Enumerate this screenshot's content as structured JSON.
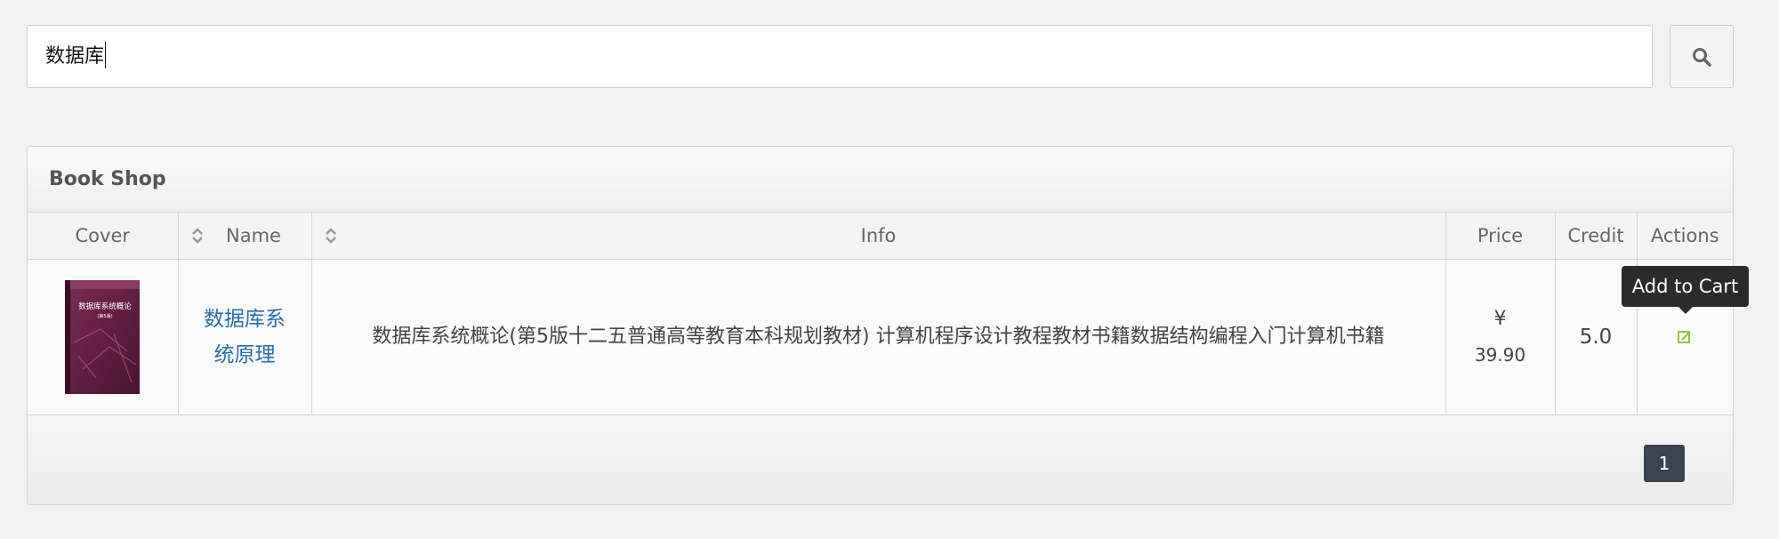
{
  "search": {
    "value": "数据库",
    "icon": "search-icon"
  },
  "panel": {
    "title": "Book Shop"
  },
  "table": {
    "columns": {
      "cover": "Cover",
      "name": "Name",
      "info": "Info",
      "price": "Price",
      "credit": "Credit",
      "actions": "Actions"
    },
    "rows": [
      {
        "cover_title": "数据库系统概论",
        "cover_edition": "(第5版)",
        "name": "数据库系统原理",
        "info": "数据库系统概论(第5版十二五普通高等教育本科规划教材) 计算机程序设计教程教材书籍数据结构编程入门计算机书籍",
        "price_symbol": "¥",
        "price": "39.90",
        "credit": "5.0",
        "action_icon": "edit-icon"
      }
    ]
  },
  "tooltip": {
    "text": "Add to Cart"
  },
  "pagination": {
    "current_page": "1"
  },
  "colors": {
    "link": "#2a6ea8",
    "action_icon": "#8dc63f",
    "pagination_bg": "#3a4350",
    "tooltip_bg": "#2b2b2b"
  }
}
